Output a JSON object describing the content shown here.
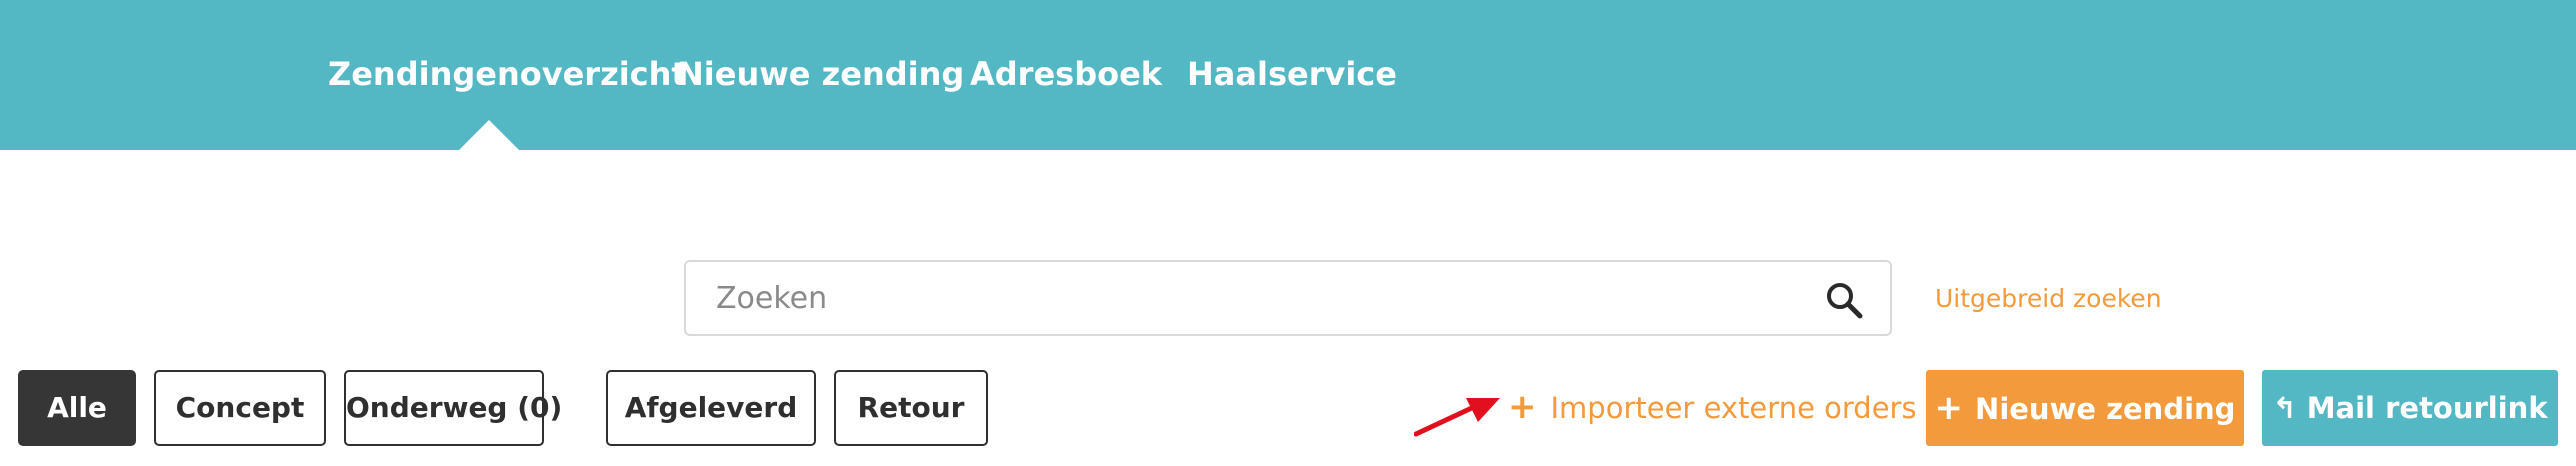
{
  "nav": {
    "items": [
      {
        "label": "Zendingenoverzicht",
        "active": true
      },
      {
        "label": "Nieuwe zending",
        "active": false
      },
      {
        "label": "Adresboek",
        "active": false
      },
      {
        "label": "Haalservice",
        "active": false
      }
    ]
  },
  "search": {
    "placeholder": "Zoeken",
    "value": "",
    "advanced_label": "Uitgebreid zoeken"
  },
  "filters": [
    {
      "label": "Alle",
      "active": true
    },
    {
      "label": "Concept",
      "active": false
    },
    {
      "label": "Onderweg (0)",
      "active": false
    },
    {
      "label": "Afgeleverd",
      "active": false
    },
    {
      "label": "Retour",
      "active": false
    }
  ],
  "actions": {
    "import_label": "Importeer externe orders",
    "import_plus": "+",
    "new_shipment_label": "Nieuwe zending",
    "new_shipment_plus": "+",
    "mail_return_label": "Mail retourlink",
    "mail_return_icon": "↰"
  },
  "colors": {
    "topbar": "#53b8c4",
    "accent_orange": "#f39a3c",
    "active_filter": "#363636",
    "arrow_red": "#e0101e"
  },
  "icons": {
    "search": "search-icon",
    "reply": "reply-icon",
    "plus": "plus-icon",
    "annotation_arrow": "arrow-icon"
  }
}
